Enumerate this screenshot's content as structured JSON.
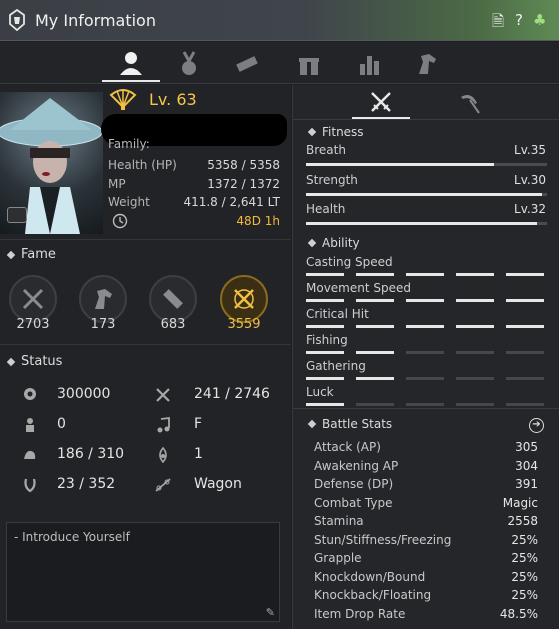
{
  "window": {
    "title": "My Information"
  },
  "character": {
    "level": "Lv. 63",
    "family_label": "Family:",
    "health_label": "Health (HP)",
    "health_value": "5358 / 5358",
    "mp_label": "MP",
    "mp_value": "1372 / 1372",
    "weight_label": "Weight",
    "weight_value": "411.8 / 2,641 LT",
    "time_value": "48D 1h"
  },
  "fame": {
    "title": "Fame",
    "items": [
      {
        "icon": "combat-fame-icon",
        "value": "2703"
      },
      {
        "icon": "life-fame-icon",
        "value": "173"
      },
      {
        "icon": "contribution-fame-icon",
        "value": "683"
      },
      {
        "icon": "total-fame-icon",
        "value": "3559",
        "highlight": true
      }
    ]
  },
  "status": {
    "title": "Status",
    "left": [
      {
        "icon": "energy-icon",
        "value": "300000"
      },
      {
        "icon": "bounty-icon",
        "value": "0"
      },
      {
        "icon": "strength-icon",
        "value": "186 / 310"
      },
      {
        "icon": "horse-icon",
        "value": "23 / 352"
      }
    ],
    "right": [
      {
        "icon": "tools-icon",
        "value": "241 / 2746"
      },
      {
        "icon": "music-icon",
        "value": "F"
      },
      {
        "icon": "contribution-icon",
        "value": "1"
      },
      {
        "icon": "wagon-icon",
        "value": "Wagon"
      }
    ]
  },
  "introduce": {
    "placeholder": "- Introduce Yourself"
  },
  "fitness": {
    "title": "Fitness",
    "items": [
      {
        "label": "Breath",
        "level": "Lv.35",
        "fill": 0.78
      },
      {
        "label": "Strength",
        "level": "Lv.30",
        "fill": 0.98
      },
      {
        "label": "Health",
        "level": "Lv.32",
        "fill": 0.96
      }
    ]
  },
  "ability": {
    "title": "Ability",
    "items": [
      {
        "label": "Casting Speed",
        "filled": 5
      },
      {
        "label": "Movement Speed",
        "filled": 5
      },
      {
        "label": "Critical Hit",
        "filled": 5
      },
      {
        "label": "Fishing",
        "filled": 2
      },
      {
        "label": "Gathering",
        "filled": 2
      },
      {
        "label": "Luck",
        "filled": 1
      }
    ]
  },
  "battle_stats": {
    "title": "Battle Stats",
    "rows": [
      {
        "label": "Attack (AP)",
        "value": "305"
      },
      {
        "label": "Awakening AP",
        "value": "304"
      },
      {
        "label": "Defense (DP)",
        "value": "391"
      },
      {
        "label": "Combat Type",
        "value": "Magic"
      },
      {
        "label": "Stamina",
        "value": "2558"
      },
      {
        "label": "Stun/Stiffness/Freezing",
        "value": "25%"
      },
      {
        "label": "Grapple",
        "value": "25%"
      },
      {
        "label": "Knockdown/Bound",
        "value": "25%"
      },
      {
        "label": "Knockback/Floating",
        "value": "25%"
      },
      {
        "label": "Item Drop Rate",
        "value": "48.5%"
      }
    ]
  },
  "colors": {
    "gold": "#f1bf43",
    "bar": "#e8e8e8",
    "panel": "#222327"
  }
}
